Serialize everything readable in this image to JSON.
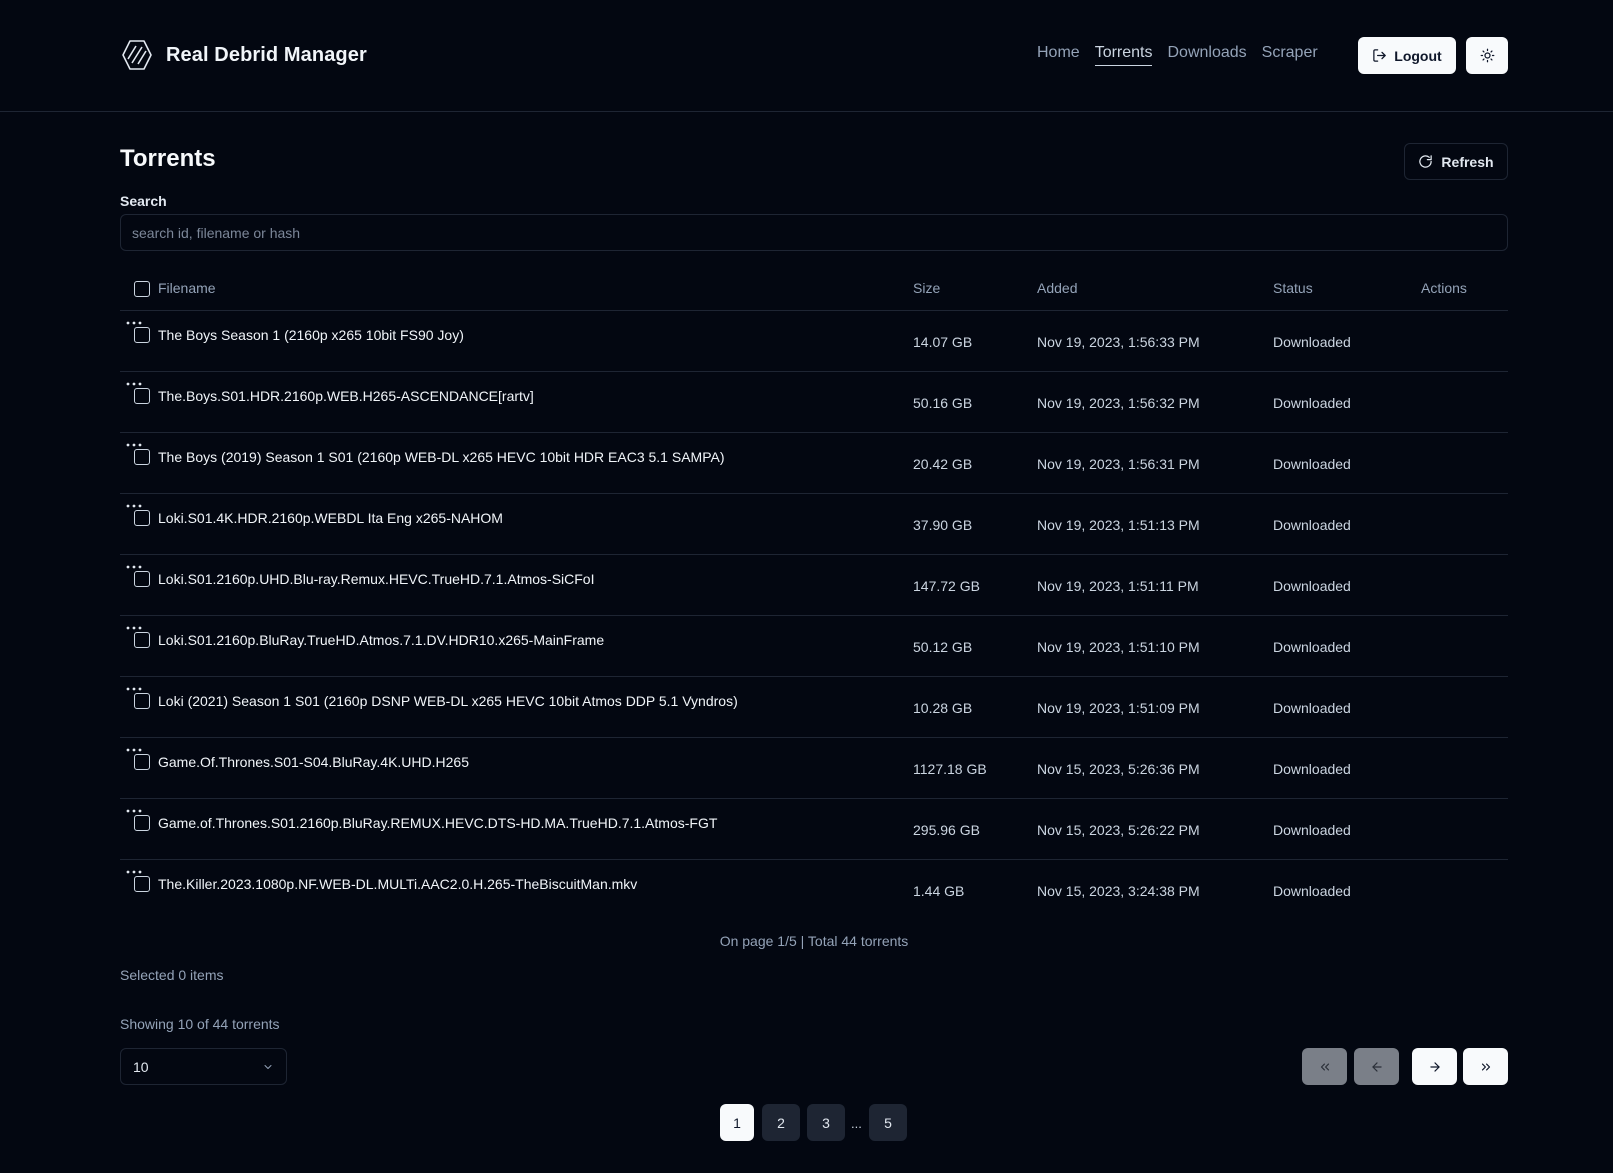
{
  "header": {
    "brand": "Real Debrid Manager",
    "nav": [
      "Home",
      "Torrents",
      "Downloads",
      "Scraper"
    ],
    "active_nav": "Torrents",
    "logout_label": "Logout"
  },
  "main": {
    "title": "Torrents",
    "refresh_label": "Refresh",
    "search_label": "Search",
    "search_placeholder": "search id, filename or hash",
    "search_value": ""
  },
  "table": {
    "columns": [
      "Filename",
      "Size",
      "Added",
      "Status",
      "Actions"
    ],
    "rows": [
      {
        "filename": "The Boys Season 1 (2160p x265 10bit FS90 Joy)",
        "size": "14.07 GB",
        "added": "Nov 19, 2023, 1:56:33 PM",
        "status": "Downloaded"
      },
      {
        "filename": "The.Boys.S01.HDR.2160p.WEB.H265-ASCENDANCE[rartv]",
        "size": "50.16 GB",
        "added": "Nov 19, 2023, 1:56:32 PM",
        "status": "Downloaded"
      },
      {
        "filename": "The Boys (2019) Season 1 S01 (2160p WEB-DL x265 HEVC 10bit HDR EAC3 5.1 SAMPA)",
        "size": "20.42 GB",
        "added": "Nov 19, 2023, 1:56:31 PM",
        "status": "Downloaded"
      },
      {
        "filename": "Loki.S01.4K.HDR.2160p.WEBDL Ita Eng x265-NAHOM",
        "size": "37.90 GB",
        "added": "Nov 19, 2023, 1:51:13 PM",
        "status": "Downloaded"
      },
      {
        "filename": "Loki.S01.2160p.UHD.Blu-ray.Remux.HEVC.TrueHD.7.1.Atmos-SiCFoI",
        "size": "147.72 GB",
        "added": "Nov 19, 2023, 1:51:11 PM",
        "status": "Downloaded"
      },
      {
        "filename": "Loki.S01.2160p.BluRay.TrueHD.Atmos.7.1.DV.HDR10.x265-MainFrame",
        "size": "50.12 GB",
        "added": "Nov 19, 2023, 1:51:10 PM",
        "status": "Downloaded"
      },
      {
        "filename": "Loki (2021) Season 1 S01 (2160p DSNP WEB-DL x265 HEVC 10bit Atmos DDP 5.1 Vyndros)",
        "size": "10.28 GB",
        "added": "Nov 19, 2023, 1:51:09 PM",
        "status": "Downloaded"
      },
      {
        "filename": "Game.Of.Thrones.S01-S04.BluRay.4K.UHD.H265",
        "size": "1127.18 GB",
        "added": "Nov 15, 2023, 5:26:36 PM",
        "status": "Downloaded"
      },
      {
        "filename": "Game.of.Thrones.S01.2160p.BluRay.REMUX.HEVC.DTS-HD.MA.TrueHD.7.1.Atmos-FGT",
        "size": "295.96 GB",
        "added": "Nov 15, 2023, 5:26:22 PM",
        "status": "Downloaded"
      },
      {
        "filename": "The.Killer.2023.1080p.NF.WEB-DL.MULTi.AAC2.0.H.265-TheBiscuitMan.mkv",
        "size": "1.44 GB",
        "added": "Nov 15, 2023, 3:24:38 PM",
        "status": "Downloaded"
      }
    ],
    "actions_icon": "ellipsis-icon"
  },
  "footer": {
    "page_info": "On page 1/5 | Total 44 torrents",
    "selected": "Selected 0 items",
    "showing": "Showing 10 of 44 torrents",
    "page_size": "10",
    "pages": [
      "1",
      "2",
      "3",
      "5"
    ],
    "ellipsis": "...",
    "current_page": "1"
  },
  "colors": {
    "background": "#030711",
    "border": "#1e2533",
    "muted_text": "#94a3b8",
    "primary_button": "#f8fafc"
  }
}
